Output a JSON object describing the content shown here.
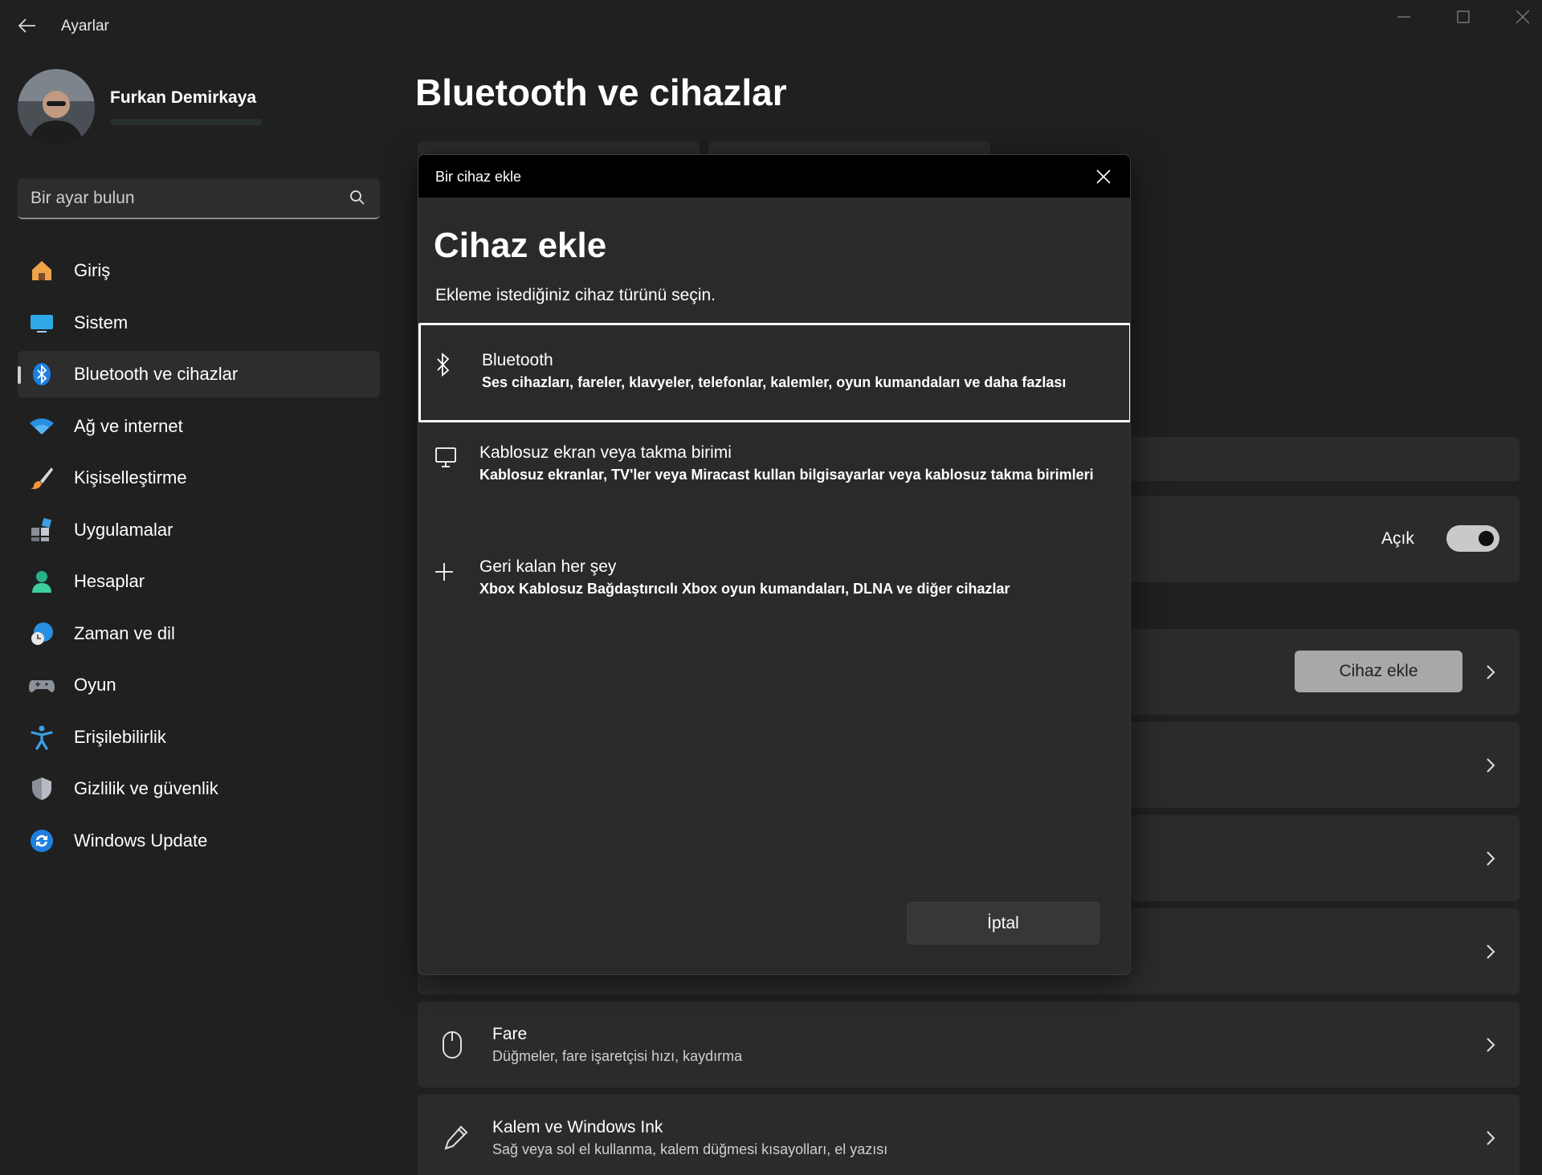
{
  "window": {
    "title": "Ayarlar"
  },
  "profile": {
    "name": "Furkan Demirkaya"
  },
  "search": {
    "placeholder": "Bir ayar bulun"
  },
  "sidebar": {
    "items": [
      {
        "label": "Giriş",
        "icon": "home-icon"
      },
      {
        "label": "Sistem",
        "icon": "system-icon"
      },
      {
        "label": "Bluetooth ve cihazlar",
        "icon": "bluetooth-icon"
      },
      {
        "label": "Ağ ve internet",
        "icon": "wifi-icon"
      },
      {
        "label": "Kişiselleştirme",
        "icon": "brush-icon"
      },
      {
        "label": "Uygulamalar",
        "icon": "apps-icon"
      },
      {
        "label": "Hesaplar",
        "icon": "account-icon"
      },
      {
        "label": "Zaman ve dil",
        "icon": "clock-globe-icon"
      },
      {
        "label": "Oyun",
        "icon": "gamepad-icon"
      },
      {
        "label": "Erişilebilirlik",
        "icon": "accessibility-icon"
      },
      {
        "label": "Gizlilik ve güvenlik",
        "icon": "shield-icon"
      },
      {
        "label": "Windows Update",
        "icon": "update-icon"
      }
    ],
    "active_index": 2
  },
  "main": {
    "page_title": "Bluetooth ve cihazlar",
    "bluetooth_toggle_label": "Açık",
    "bluetooth_toggle_on": true,
    "add_device_button": "Cihaz ekle",
    "cards": [
      {
        "title": "Fare",
        "desc": "Düğmeler, fare işaretçisi hızı, kaydırma",
        "icon": "mouse-icon"
      },
      {
        "title": "Kalem ve Windows Ink",
        "desc": "Sağ veya sol el kullanma, kalem düğmesi kısayolları, el yazısı",
        "icon": "pen-icon"
      }
    ]
  },
  "dialog": {
    "window_title": "Bir cihaz ekle",
    "heading": "Cihaz ekle",
    "subtitle": "Ekleme istediğiniz cihaz türünü seçin.",
    "options": [
      {
        "title": "Bluetooth",
        "desc": "Ses cihazları, fareler, klavyeler, telefonlar, kalemler, oyun kumandaları ve daha fazlası",
        "icon": "bluetooth-icon",
        "selected": true
      },
      {
        "title": "Kablosuz ekran veya takma birimi",
        "desc": "Kablosuz ekranlar, TV'ler veya Miracast kullan bilgisayarlar veya kablosuz takma birimleri",
        "icon": "monitor-icon",
        "selected": false
      },
      {
        "title": "Geri kalan her şey",
        "desc": "Xbox Kablosuz Bağdaştırıcılı Xbox oyun kumandaları, DLNA ve diğer cihazlar",
        "icon": "plus-icon",
        "selected": false
      }
    ],
    "cancel_button": "İptal"
  },
  "colors": {
    "background": "#202020",
    "card": "#2b2b2b",
    "dialog": "#2a2a2a",
    "dialog_titlebar": "#000000",
    "accent_blue": "#1e90ff"
  }
}
